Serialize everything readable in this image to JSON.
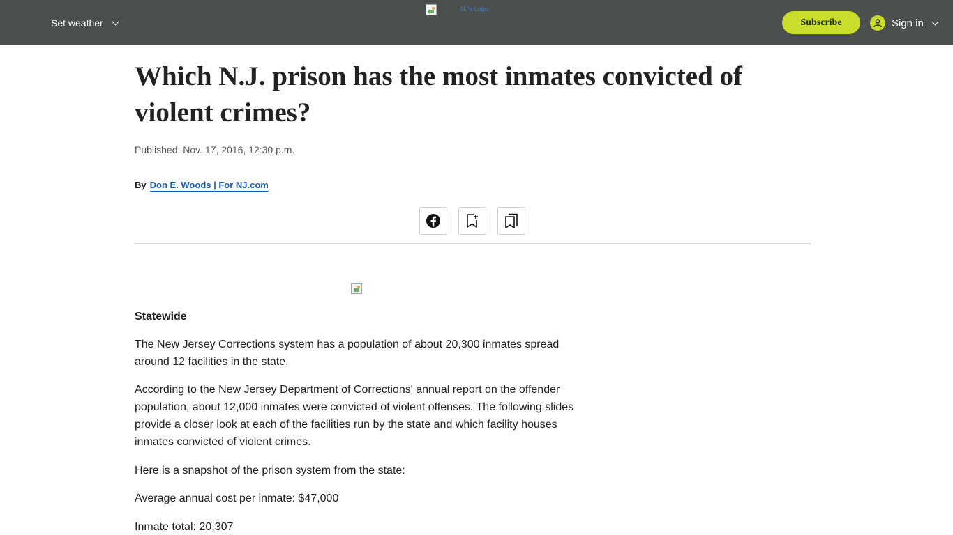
{
  "header": {
    "weather_label": "Set weather",
    "logo_alt": "NJ's Logo",
    "subscribe_label": "Subscribe",
    "signin_label": "Sign in",
    "accent_color": "#c9dd2a",
    "bar_color": "#4b4f4f"
  },
  "article": {
    "title": "Which N.J. prison has the most inmates convicted of violent crimes?",
    "published": "Published: Nov. 17, 2016, 12:30 p.m.",
    "by_label": "By",
    "author": "Don E. Woods | For NJ.com",
    "share_icons": [
      "facebook-icon",
      "bookmark-add-icon",
      "bookmarks-icon"
    ],
    "section_heading": "Statewide",
    "paragraphs": [
      "The New Jersey Corrections system has a population of about 20,300 inmates spread around 12 facilities in the state.",
      "According to the New Jersey Department of Corrections' annual report on the offender population, about 12,000 inmates were convicted of violent offenses. The following slides provide a closer look at each of the facilities run by the state and which facility houses inmates convicted of violent crimes.",
      "Here is a snapshot of the prison system from the state:",
      "Average annual cost per inmate: $47,000",
      "Inmate total: 20,307"
    ]
  }
}
